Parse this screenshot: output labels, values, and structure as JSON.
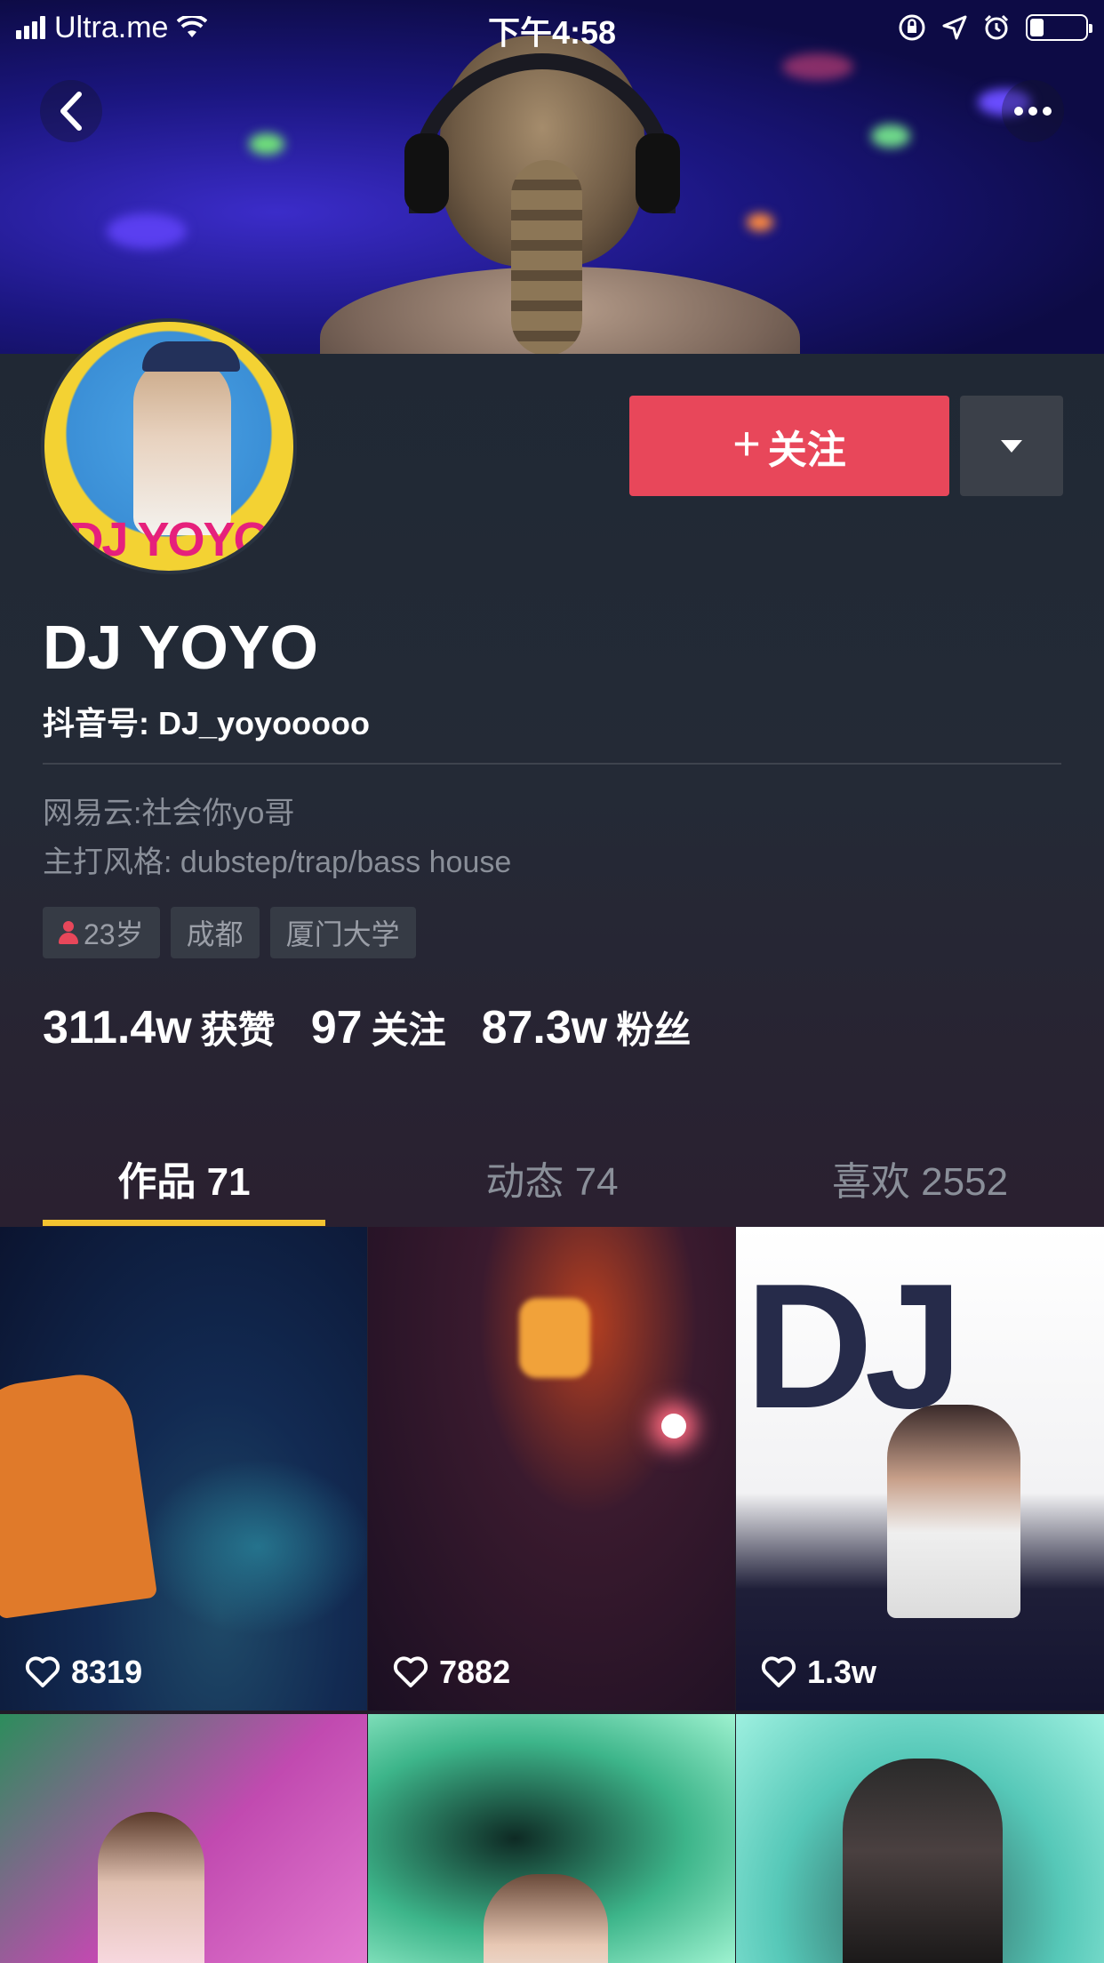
{
  "status_bar": {
    "carrier": "Ultra.me",
    "time": "下午4:58",
    "battery_level": 0.25
  },
  "nav": {
    "back_icon": "chevron-left-icon",
    "more_icon": "ellipsis-icon"
  },
  "profile": {
    "name": "DJ YOYO",
    "douyin_id": "抖音号: DJ_yoyooooo",
    "avatar_text": "DJ YOYO",
    "bio_line1": "网易云:社会你yo哥",
    "bio_line2": "主打风格:  dubstep/trap/bass house",
    "tags": [
      {
        "label": "23岁",
        "icon": "person-icon"
      },
      {
        "label": "成都"
      },
      {
        "label": "厦门大学"
      }
    ]
  },
  "actions": {
    "follow_plus": "+",
    "follow_label": "关注",
    "follow_color": "#e8475a"
  },
  "stats": [
    {
      "num": "311.4w",
      "label": "获赞"
    },
    {
      "num": "97",
      "label": "关注"
    },
    {
      "num": "87.3w",
      "label": "粉丝"
    }
  ],
  "tabs": [
    {
      "label": "作品 71",
      "active": true
    },
    {
      "label": "动态 74",
      "active": false
    },
    {
      "label": "喜欢 2552",
      "active": false
    }
  ],
  "tab_underline_color": "#f4c330",
  "videos": [
    {
      "likes": "8319"
    },
    {
      "likes": "7882"
    },
    {
      "likes": "1.3w"
    },
    {
      "likes": ""
    },
    {
      "likes": ""
    },
    {
      "likes": ""
    }
  ],
  "video_overlay": {
    "c3_text": "DJ"
  }
}
